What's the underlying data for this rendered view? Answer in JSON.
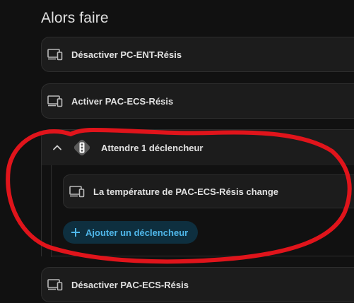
{
  "section": {
    "title": "Alors faire"
  },
  "actions": [
    {
      "label": "Désactiver PC-ENT-Résis",
      "icon": "device-icon"
    },
    {
      "label": "Activer PAC-ECS-Résis",
      "icon": "device-icon"
    }
  ],
  "wait_block": {
    "label": "Attendre 1 déclencheur",
    "icon": "traffic-light-icon",
    "expand_icon": "chevron-up-icon",
    "triggers": [
      {
        "label": "La température de PAC-ECS-Résis change",
        "icon": "device-icon"
      }
    ],
    "add_button_label": "Ajouter un déclencheur",
    "add_button_icon": "plus-icon"
  },
  "actions_after": [
    {
      "label": "Désactiver PAC-ECS-Résis",
      "icon": "device-icon"
    }
  ],
  "colors": {
    "background": "#111111",
    "card": "#1c1c1c",
    "border": "#2e2e2e",
    "text": "#e1e1e1",
    "accent": "#4fb7ea",
    "accent_bg": "#0e2f3f",
    "annotation": "#e0141b"
  }
}
